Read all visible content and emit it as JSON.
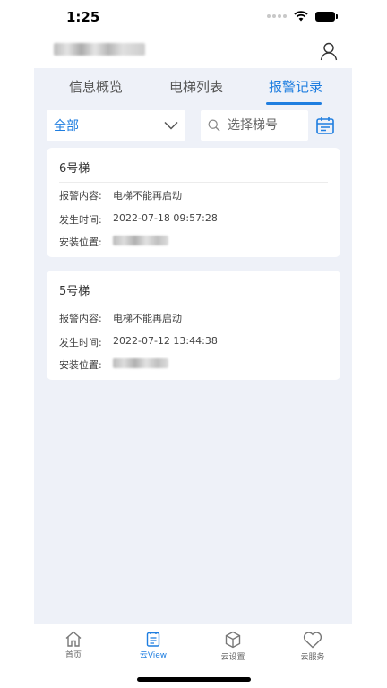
{
  "status_bar": {
    "time": "1:25"
  },
  "tabs": [
    {
      "label": "信息概览",
      "active": false
    },
    {
      "label": "电梯列表",
      "active": false
    },
    {
      "label": "报警记录",
      "active": true
    }
  ],
  "filter": {
    "selected": "全部"
  },
  "search": {
    "placeholder": "选择梯号"
  },
  "alarms": [
    {
      "title": "6号梯",
      "content_label": "报警内容:",
      "content": "电梯不能再启动",
      "time_label": "发生时间:",
      "time": "2022-07-18 09:57:28",
      "location_label": "安装位置:"
    },
    {
      "title": "5号梯",
      "content_label": "报警内容:",
      "content": "电梯不能再启动",
      "time_label": "发生时间:",
      "time": "2022-07-12 13:44:38",
      "location_label": "安装位置:"
    }
  ],
  "bottom_nav": [
    {
      "label": "首页",
      "icon": "home-icon",
      "active": false
    },
    {
      "label": "云View",
      "icon": "document-icon",
      "active": true
    },
    {
      "label": "云设置",
      "icon": "cube-icon",
      "active": false
    },
    {
      "label": "云服务",
      "icon": "heart-icon",
      "active": false
    }
  ],
  "colors": {
    "accent": "#1f7ee0",
    "background": "#eef1f8"
  }
}
